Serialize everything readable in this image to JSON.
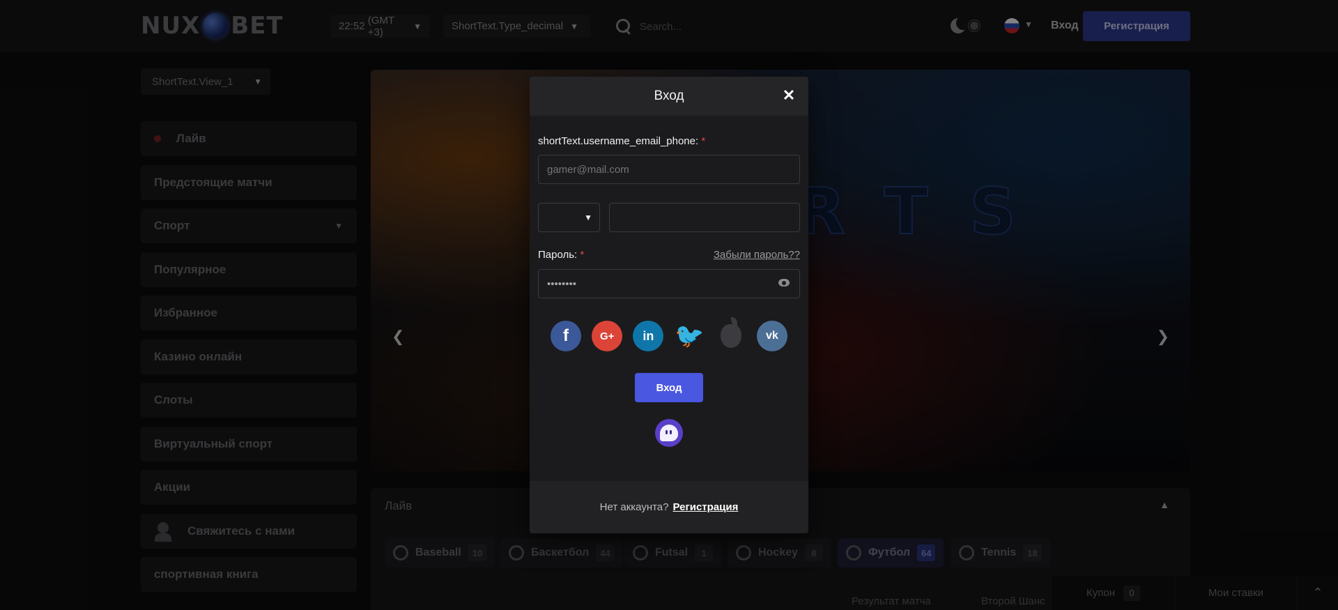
{
  "header": {
    "logo_left": "NUX",
    "logo_right": "BET",
    "time": "22:52",
    "timezone": "(GMT +3)",
    "odds_format": "ShortText.Type_decimal",
    "search_placeholder": "Search...",
    "login_label": "Вход",
    "register_label": "Регистрация"
  },
  "sidebar": {
    "view_select": "ShortText.View_1",
    "items": [
      {
        "label": "Лайв"
      },
      {
        "label": "Предстоящие матчи"
      },
      {
        "label": "Спорт"
      },
      {
        "label": "Популярное"
      },
      {
        "label": "Избранное"
      },
      {
        "label": "Казино онлайн"
      },
      {
        "label": "Слоты"
      },
      {
        "label": "Виртуальный спорт"
      },
      {
        "label": "Акции"
      },
      {
        "label": "Свяжитесь с нами"
      },
      {
        "label": "спортивная книга"
      }
    ]
  },
  "banner": {
    "word": "RTS"
  },
  "live": {
    "title": "Лайв",
    "tabs": [
      {
        "label": "Baseball",
        "count": "10"
      },
      {
        "label": "Баскетбол",
        "count": "44"
      },
      {
        "label": "Futsal",
        "count": "1"
      },
      {
        "label": "Hockey",
        "count": "8"
      },
      {
        "label": "Футбол",
        "count": "64"
      },
      {
        "label": "Tennis",
        "count": "18"
      }
    ],
    "columns": [
      "Результат матча",
      "Второй Шанс"
    ]
  },
  "bottom_bar": {
    "coupon_label": "Купон",
    "coupon_count": "0",
    "my_bets_label": "Мои ставки"
  },
  "modal": {
    "title": "Вход",
    "username_label": "shortText.username_email_phone:",
    "required_mark": "*",
    "username_placeholder": "gamer@mail.com",
    "password_label": "Пароль:",
    "forgot_password": "Забыли пароль??",
    "password_value": "••••••••",
    "submit_label": "Вход",
    "no_account": "Нет аккаунта?",
    "register_link": "Регистрация",
    "social": [
      "facebook",
      "google-plus",
      "linkedin",
      "twitter",
      "apple",
      "vk"
    ]
  },
  "colors": {
    "accent": "#4a57e0",
    "register_button": "#2e3a8a",
    "required": "#e04848"
  }
}
